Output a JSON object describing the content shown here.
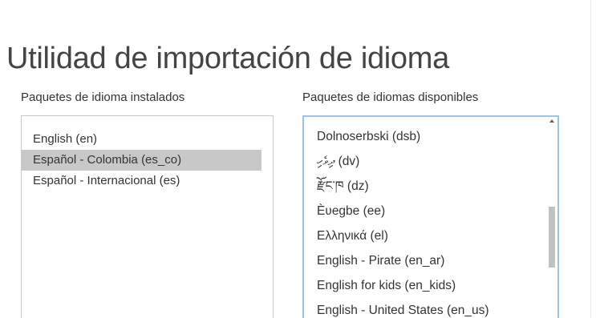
{
  "title": "Utilidad de importación de idioma",
  "installed": {
    "label": "Paquetes de idioma instalados",
    "items": [
      {
        "label": "English (en)",
        "selected": false
      },
      {
        "label": "Español - Colombia (es_co)",
        "selected": true
      },
      {
        "label": "Español - Internacional (es)",
        "selected": false
      }
    ]
  },
  "available": {
    "label": "Paquetes de idiomas disponibles",
    "items": [
      {
        "label": "Dolnoserbski (dsb)"
      },
      {
        "label": "ދިވެހި (dv)"
      },
      {
        "label": "རྫོང་ཁ (dz)"
      },
      {
        "label": "Èʋegbe (ee)"
      },
      {
        "label": "Ελληνικά (el)"
      },
      {
        "label": "English - Pirate (en_ar)"
      },
      {
        "label": "English for kids (en_kids)"
      },
      {
        "label": "English - United States (en_us)"
      }
    ]
  },
  "colors": {
    "selected_bg": "#c8c8c8",
    "focus_border": "#9dc3ea",
    "scroll_thumb": "#c1c1c1"
  }
}
